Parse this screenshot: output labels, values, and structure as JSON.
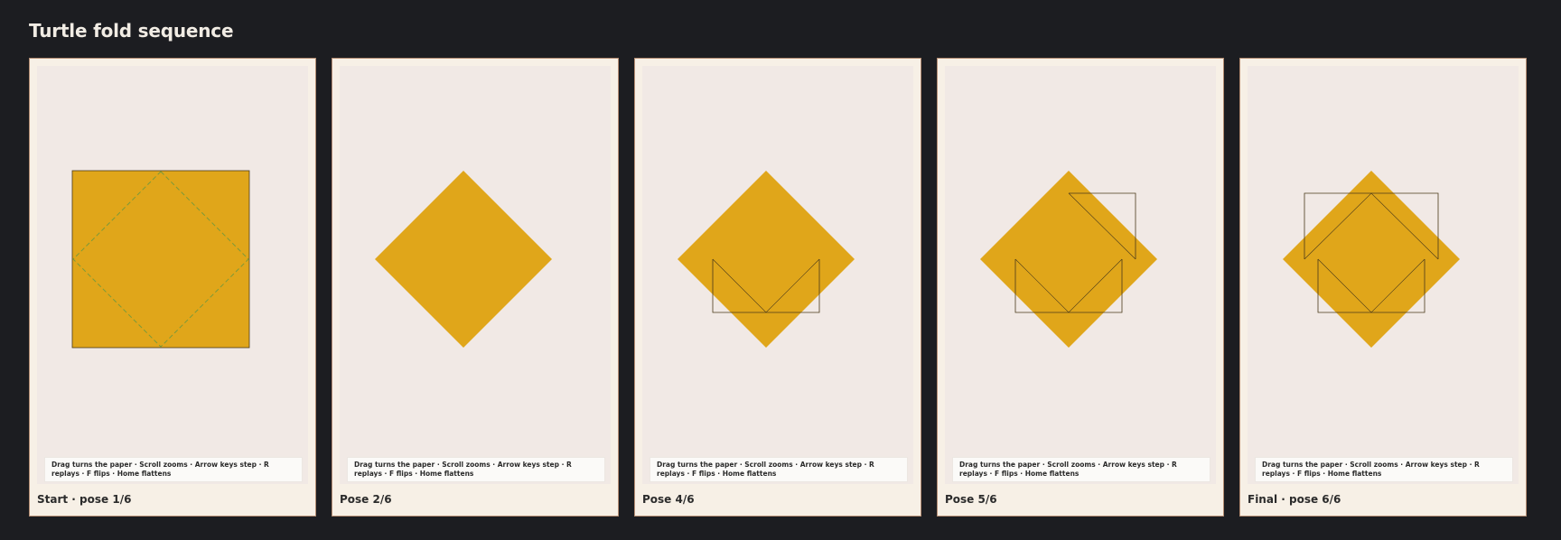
{
  "page": {
    "title": "Turtle fold sequence"
  },
  "hint_text": "Drag turns the paper · Scroll zooms · Arrow keys step · R replays · F flips · Home flattens",
  "colors": {
    "background": "#1c1d21",
    "paper": "#e0a61a",
    "crease": "#7b9a3a",
    "panel": "#f7f0e6",
    "stage": "#f1e9e5"
  },
  "panels": [
    {
      "caption": "Start · pose 1/6"
    },
    {
      "caption": "Pose 2/6"
    },
    {
      "caption": "Pose 4/6"
    },
    {
      "caption": "Pose 5/6"
    },
    {
      "caption": "Final · pose 6/6"
    }
  ]
}
